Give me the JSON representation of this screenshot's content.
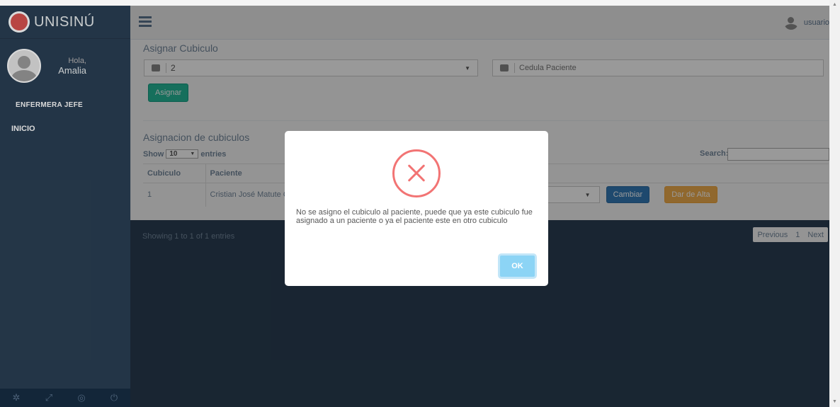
{
  "brand": {
    "name": "UNISINÚ"
  },
  "profile": {
    "greeting": "Hola,",
    "name": "Amalia",
    "role": "ENFERMERA JEFE"
  },
  "nav": {
    "inicio": "INICIO"
  },
  "topbar": {
    "user": "usuario"
  },
  "assign_section": {
    "title": "Asignar Cubiculo",
    "cubicle_selected": "2",
    "patient_placeholder": "Cedula Paciente",
    "assign_button": "Asignar"
  },
  "table_section": {
    "title": "Asignacion de cubiculos",
    "show_label": "Show",
    "entries_label": "entries",
    "page_length": "10",
    "search_label": "Search:",
    "columns": [
      "Cubiculo",
      "Paciente"
    ],
    "rows": [
      {
        "cubiculo": "1",
        "paciente": "Cristian José Matute Q",
        "change_button": "Cambiar",
        "discharge_button": "Dar de Alta"
      }
    ],
    "info": "Showing 1 to 1 of 1 entries",
    "pager": {
      "previous": "Previous",
      "page": "1",
      "next": "Next"
    }
  },
  "modal": {
    "message": "No se asigno el cubiculo al paciente, puede que ya este cubiculo fue asignado a un paciente o ya el paciente este en otro cubiculo",
    "ok_button": "OK",
    "icon": "error-x-icon",
    "accent_color": "#f27474"
  },
  "colors": {
    "sidebar": "#2a3f54",
    "success": "#26b99a",
    "primary": "#337ab7",
    "warning": "#f0ad4e"
  }
}
